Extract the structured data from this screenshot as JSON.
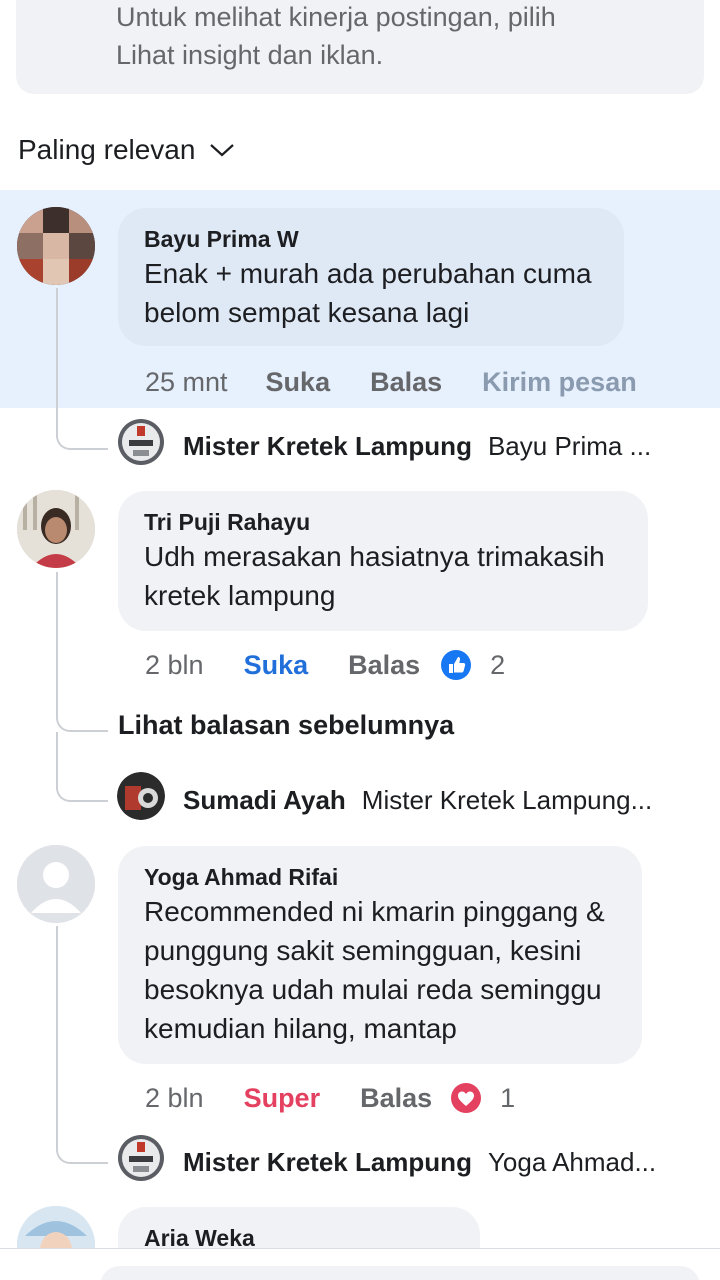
{
  "info": {
    "line1": "Untuk melihat kinerja postingan, pilih",
    "line2": "Lihat insight dan iklan."
  },
  "sort": {
    "label": "Paling relevan"
  },
  "comments": [
    {
      "name": "Bayu Prima W",
      "lines": [
        "Enak + murah ada perubahan cuma",
        "belom sempat kesana lagi"
      ],
      "time": "25 mnt",
      "like": "Suka",
      "reply": "Balas",
      "message": "Kirim pesan"
    },
    {
      "name": "Tri Puji Rahayu",
      "lines": [
        "Udh merasakan hasiatnya trimakasih",
        "kretek lampung"
      ],
      "time": "2 bln",
      "like": "Suka",
      "reply": "Balas",
      "reaction_count": "2"
    },
    {
      "name": "Yoga Ahmad Rifai",
      "lines": [
        "Recommended ni kmarin pinggang &",
        "punggung sakit semingguan, kesini",
        "besoknya udah mulai reda seminggu",
        "kemudian hilang, mantap"
      ],
      "time": "2 bln",
      "like": "Super",
      "reply": "Balas",
      "reaction_count": "1"
    },
    {
      "name": "Aria Weka"
    }
  ],
  "replies": [
    {
      "name": "Mister Kretek Lampung",
      "text": "Bayu Prima ..."
    },
    {
      "name": "Sumadi Ayah",
      "text": "Mister Kretek Lampung..."
    },
    {
      "name": "Mister Kretek Lampung",
      "text": "Yoga Ahmad..."
    }
  ],
  "see_previous": "Lihat balasan sebelumnya",
  "colors": {
    "accent": "#216fdb",
    "love": "#e4405f",
    "highlight": "#e7f0fd",
    "bubble": "#f0f2f5"
  }
}
